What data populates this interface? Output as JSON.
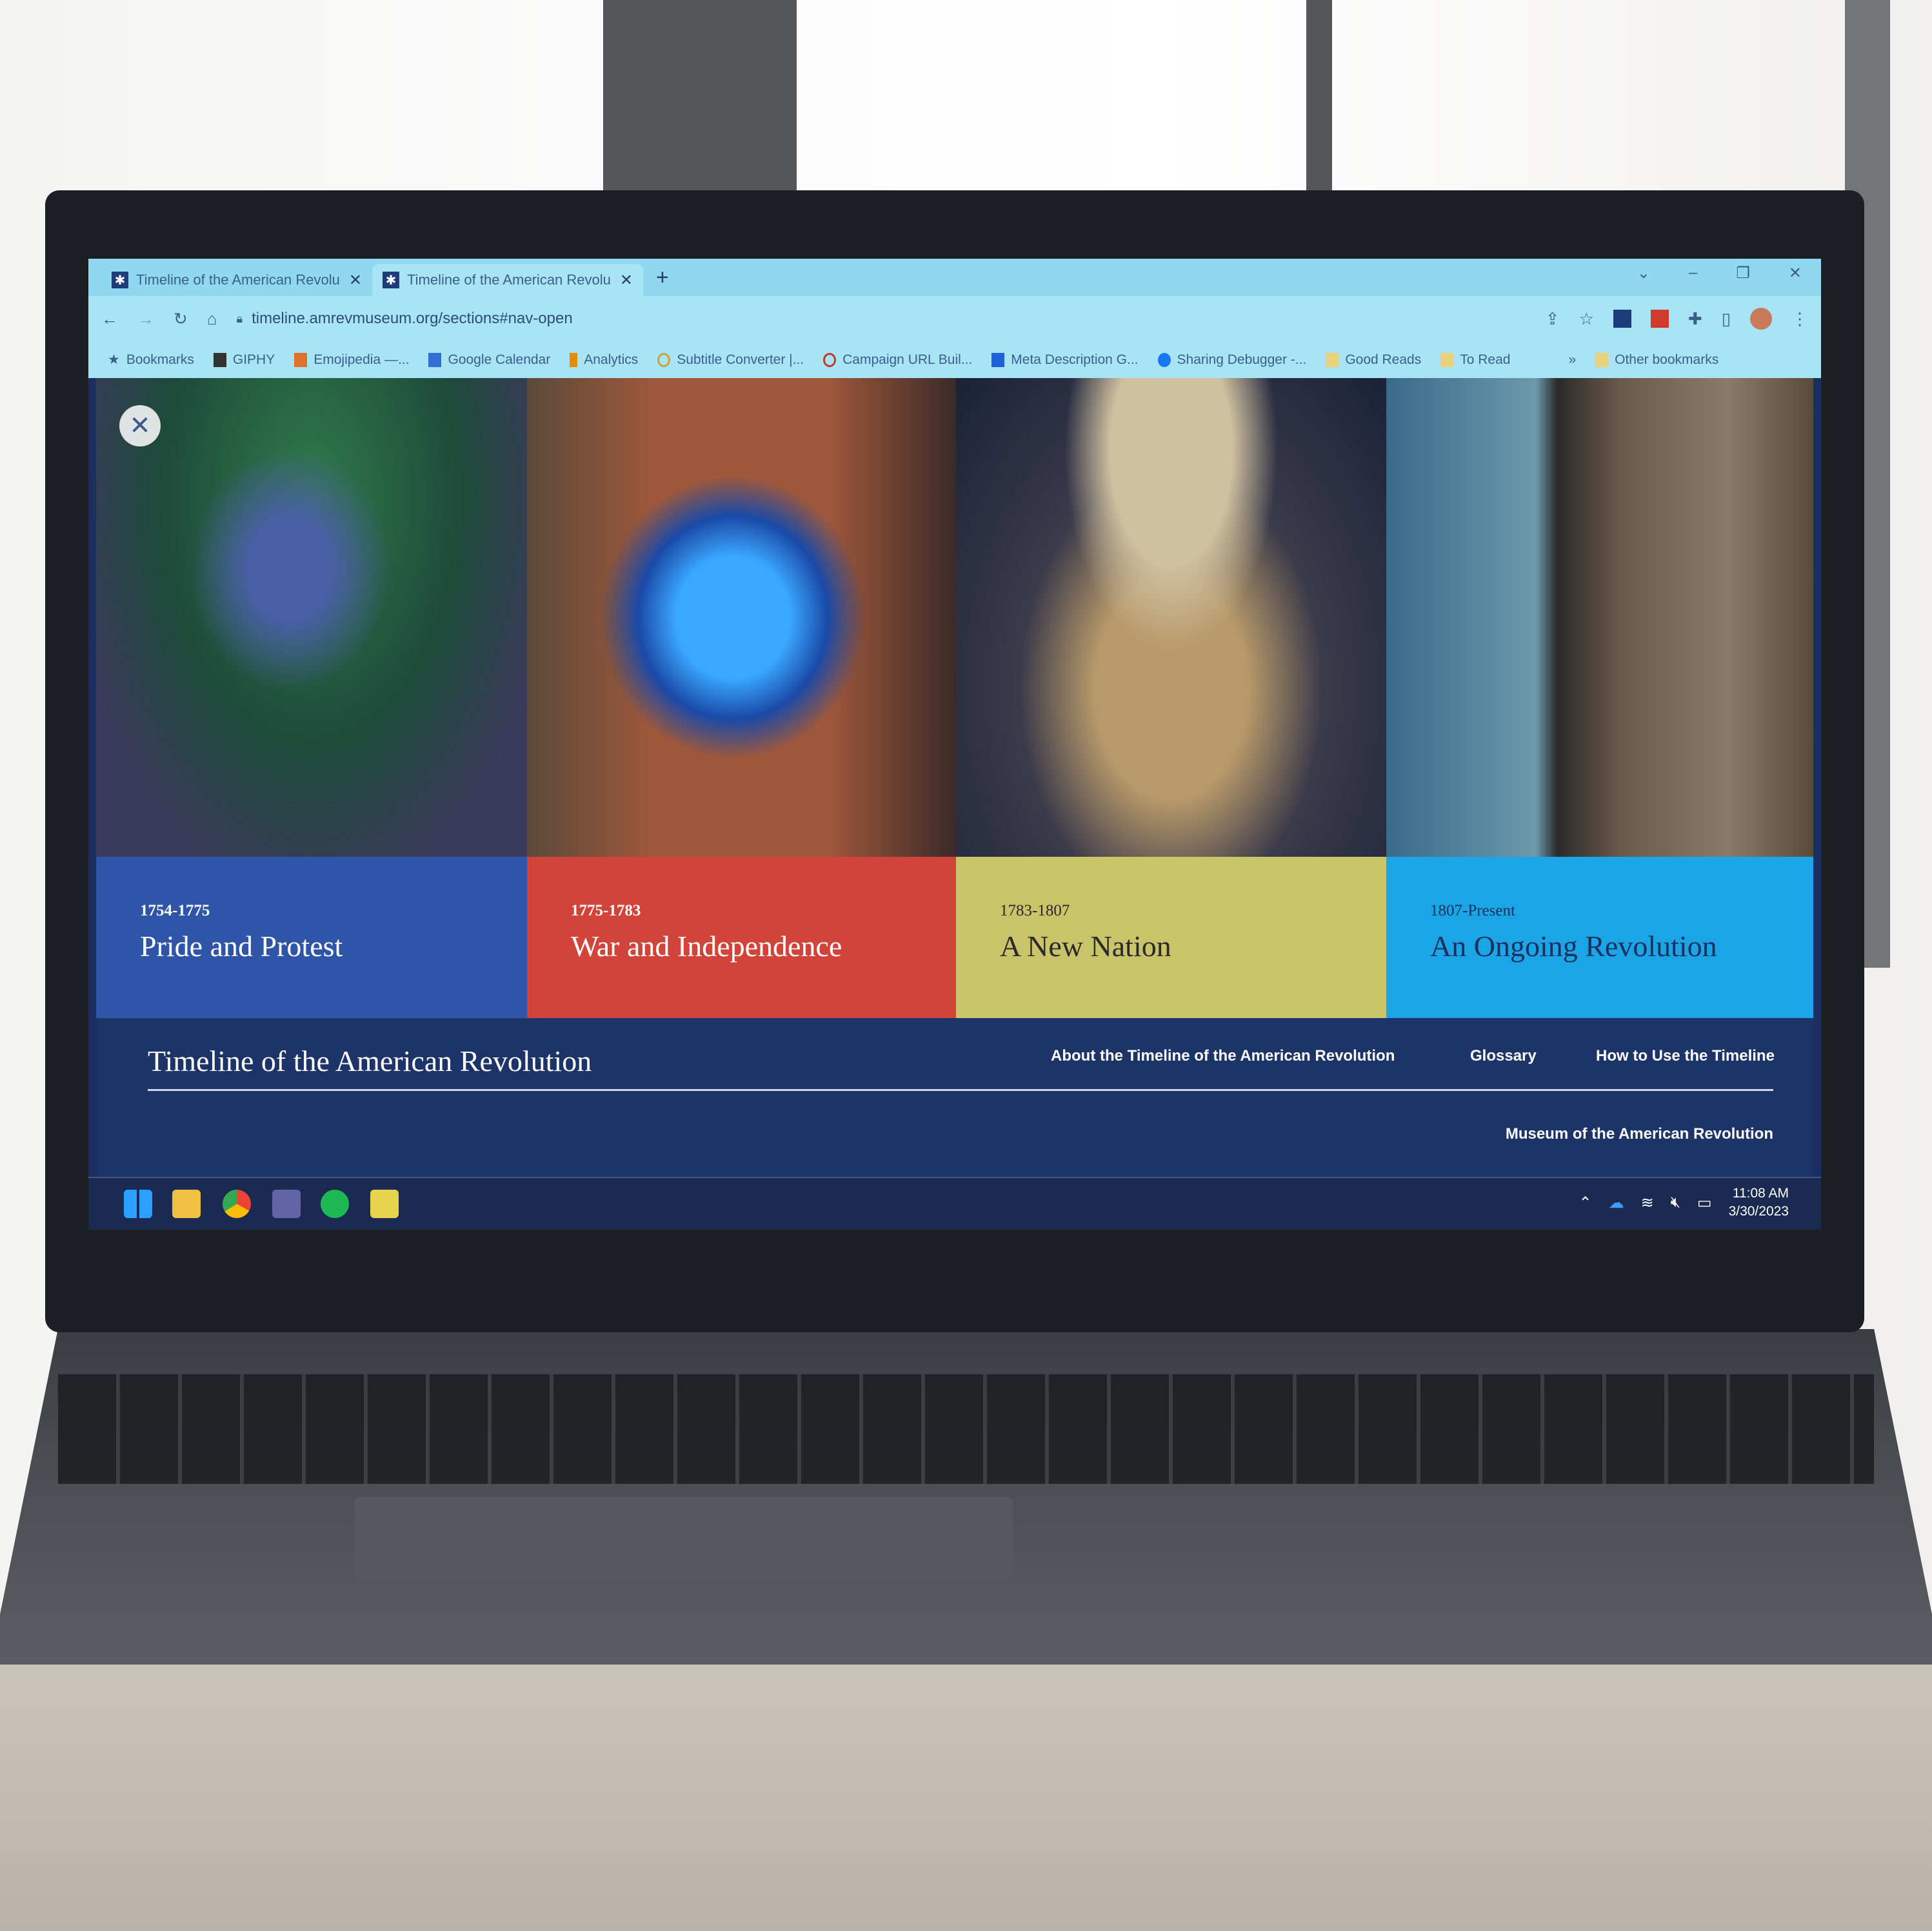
{
  "browser": {
    "tabs": [
      {
        "title": "Timeline of the American Revolu",
        "active": false
      },
      {
        "title": "Timeline of the American Revolu",
        "active": true
      }
    ],
    "new_tab": "+",
    "url": "timeline.amrevmuseum.org/sections#nav-open",
    "window_controls": [
      "chevron-down",
      "minimize",
      "restore",
      "close"
    ],
    "bookmarks": [
      {
        "label": "Bookmarks",
        "icon": "star-icon",
        "color": "#2c4c7a"
      },
      {
        "label": "GIPHY",
        "icon": "giphy-icon",
        "color": "#333"
      },
      {
        "label": "Emojipedia —...",
        "icon": "emojipedia-icon",
        "color": "#e0702a"
      },
      {
        "label": "Google Calendar",
        "icon": "calendar-icon",
        "color": "#2f6fd6"
      },
      {
        "label": "Analytics",
        "icon": "analytics-icon",
        "color": "#e68a00"
      },
      {
        "label": "Subtitle Converter |...",
        "icon": "subtitle-icon",
        "color": "#c9a23a"
      },
      {
        "label": "Campaign URL Buil...",
        "icon": "campaign-icon",
        "color": "#c0392b"
      },
      {
        "label": "Meta Description G...",
        "icon": "meta-icon",
        "color": "#2061d6"
      },
      {
        "label": "Sharing Debugger -...",
        "icon": "facebook-icon",
        "color": "#1877f2"
      },
      {
        "label": "Good Reads",
        "icon": "folder-icon",
        "color": "#e5d27a"
      },
      {
        "label": "To Read",
        "icon": "folder-icon",
        "color": "#e5d27a"
      }
    ],
    "overflow": "»",
    "other_bookmarks": "Other bookmarks"
  },
  "page": {
    "close_label": "✕",
    "periods": [
      {
        "dates": "1754-1775",
        "title": "Pride and Protest",
        "color": "#2f55a8",
        "text": "#ffffff"
      },
      {
        "dates": "1775-1783",
        "title": "War and Independence",
        "color": "#d2443a",
        "text": "#ffffff"
      },
      {
        "dates": "1783-1807",
        "title": "A New Nation",
        "color": "#c9c36a",
        "text": "#2a2a2a"
      },
      {
        "dates": "1807-Present",
        "title": "An Ongoing Revolution",
        "color": "#1aa6e6",
        "text": "#1d2f5c"
      }
    ],
    "nav": {
      "title": "Timeline of the American Revolution",
      "links": [
        "About the Timeline of the American Revolution",
        "Glossary",
        "How to Use the Timeline"
      ],
      "museum_link": "Museum of the American Revolution"
    }
  },
  "taskbar": {
    "apps": [
      "windows-start-icon",
      "file-explorer-icon",
      "chrome-icon",
      "teams-icon",
      "spotify-icon",
      "sticky-notes-icon"
    ],
    "time": "11:08 AM",
    "date": "3/30/2023"
  }
}
